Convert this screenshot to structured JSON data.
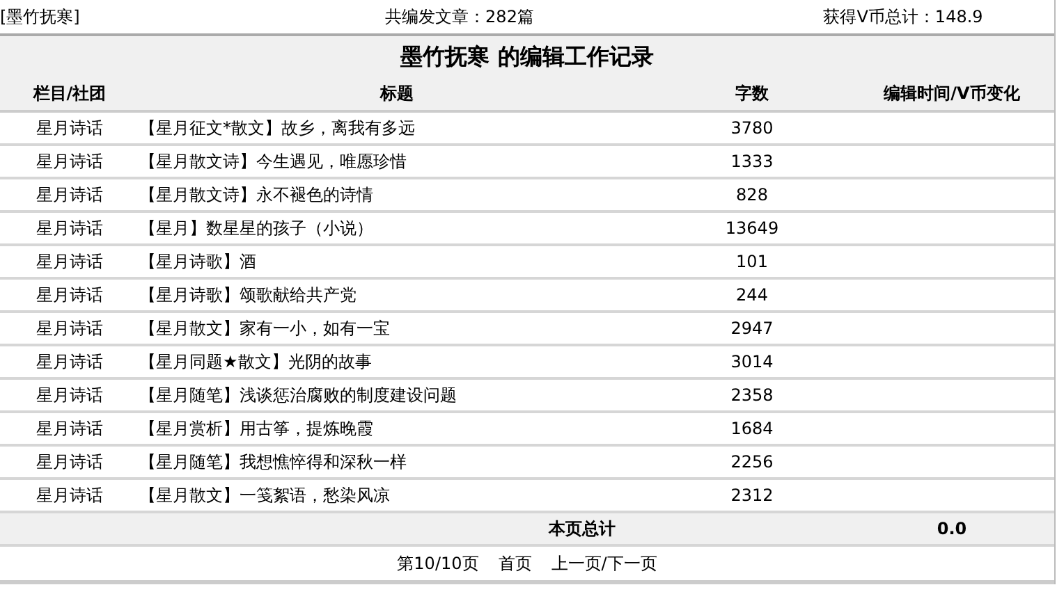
{
  "header": {
    "user": "[墨竹抚寒]",
    "article_count": "共编发文章：282篇",
    "vcoin_total": "获得V币总计：148.9"
  },
  "title": "墨竹抚寒 的编辑工作记录",
  "table": {
    "columns": [
      "栏目/社团",
      "标题",
      "字数",
      "编辑时间/V币变化"
    ],
    "rows": [
      {
        "section": "星月诗话",
        "title": "【星月征文*散文】故乡，离我有多远",
        "words": "3780"
      },
      {
        "section": "星月诗话",
        "title": "【星月散文诗】今生遇见，唯愿珍惜",
        "words": "1333"
      },
      {
        "section": "星月诗话",
        "title": "【星月散文诗】永不褪色的诗情",
        "words": "828"
      },
      {
        "section": "星月诗话",
        "title": "【星月】数星星的孩子（小说）",
        "words": "13649"
      },
      {
        "section": "星月诗话",
        "title": "【星月诗歌】酒",
        "words": "101"
      },
      {
        "section": "星月诗话",
        "title": "【星月诗歌】颂歌献给共产党",
        "words": "244"
      },
      {
        "section": "星月诗话",
        "title": "【星月散文】家有一小，如有一宝",
        "words": "2947"
      },
      {
        "section": "星月诗话",
        "title": "【星月同题★散文】光阴的故事",
        "words": "3014"
      },
      {
        "section": "星月诗话",
        "title": "【星月随笔】浅谈惩治腐败的制度建设问题",
        "words": "2358"
      },
      {
        "section": "星月诗话",
        "title": "【星月赏析】用古筝，提炼晚霞",
        "words": "1684"
      },
      {
        "section": "星月诗话",
        "title": "【星月随笔】我想憔悴得和深秋一样",
        "words": "2256"
      },
      {
        "section": "星月诗话",
        "title": "【星月散文】一笺絮语，愁染风凉",
        "words": "2312"
      }
    ]
  },
  "total": {
    "label": "本页总计",
    "value": "0.0"
  },
  "pagination": {
    "page": "第10/10页",
    "first": "首页",
    "prev_next": "上一页/下一页"
  }
}
